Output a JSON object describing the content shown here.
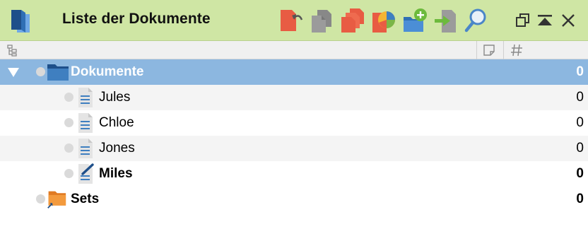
{
  "window": {
    "title": "Liste der Dokumente"
  },
  "toolbar": {
    "items": [
      {
        "name": "restore-document-icon"
      },
      {
        "name": "copy-documents-icon"
      },
      {
        "name": "duplicate-documents-icon"
      },
      {
        "name": "document-color-icon"
      },
      {
        "name": "new-document-group-icon"
      },
      {
        "name": "import-documents-icon"
      },
      {
        "name": "search-icon"
      }
    ]
  },
  "window_controls": [
    "float-window-icon",
    "collapse-window-icon",
    "close-icon"
  ],
  "columns": [
    {
      "name": "tree-column-icon"
    },
    {
      "name": "memo-column-icon"
    },
    {
      "name": "count-column-icon"
    }
  ],
  "tree": {
    "root": {
      "label": "Dokumente",
      "count": "0",
      "expanded": true,
      "selected": true
    },
    "documents": [
      {
        "label": "Jules",
        "count": "0",
        "bold": false,
        "edited": false
      },
      {
        "label": "Chloe",
        "count": "0",
        "bold": false,
        "edited": false
      },
      {
        "label": "Jones",
        "count": "0",
        "bold": false,
        "edited": false
      },
      {
        "label": "Miles",
        "count": "0",
        "bold": true,
        "edited": true
      }
    ],
    "sets": {
      "label": "Sets",
      "count": "0"
    }
  },
  "colors": {
    "titlebar": "#cfe6a4",
    "selection": "#8cb7e0",
    "folder_blue": "#2f6fb5",
    "folder_orange": "#f39a3d",
    "doc_lines": "#3f7fc0"
  }
}
